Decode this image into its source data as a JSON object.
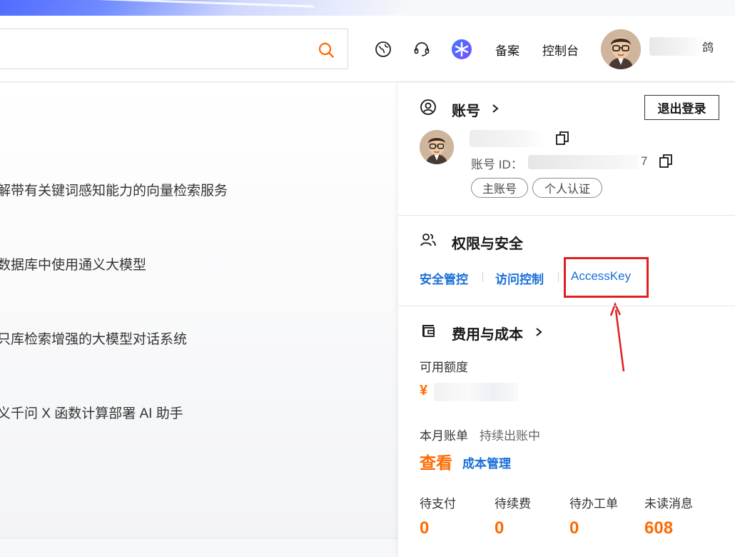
{
  "header": {
    "search": {
      "placeholder": ""
    },
    "icons": [
      "globe-icon",
      "headset-icon",
      "ai-assistant-icon"
    ],
    "beian_label": "备案",
    "console_label": "控制台",
    "username_tail": "鸽"
  },
  "content": {
    "items": [
      "解带有关键词感知能力的向量检索服务",
      "数据库中使用通义大模型",
      "只库检索增强的大模型对话系统",
      "义千问 X 函数计算部署 AI 助手"
    ]
  },
  "panel": {
    "account": {
      "title": "账号",
      "logout_label": "退出登录",
      "id_label": "账号 ID：",
      "id_tail": "7",
      "tags": [
        "主账号",
        "个人认证"
      ]
    },
    "security": {
      "title": "权限与安全",
      "links": [
        "安全管控",
        "访问控制",
        "AccessKey"
      ]
    },
    "billing": {
      "title": "费用与成本",
      "available_label": "可用额度",
      "currency": "¥",
      "month_bill_label": "本月账单",
      "month_bill_status": "持续出账中",
      "view_label": "查看",
      "cost_mgmt_label": "成本管理",
      "stats": [
        {
          "label": "待支付",
          "value": "0"
        },
        {
          "label": "待续费",
          "value": "0"
        },
        {
          "label": "待办工单",
          "value": "0"
        },
        {
          "label": "未读消息",
          "value": "608"
        }
      ]
    }
  },
  "colors": {
    "accent_orange": "#ff6a00",
    "link_blue": "#1a6fd8",
    "highlight_red": "#e02020"
  }
}
